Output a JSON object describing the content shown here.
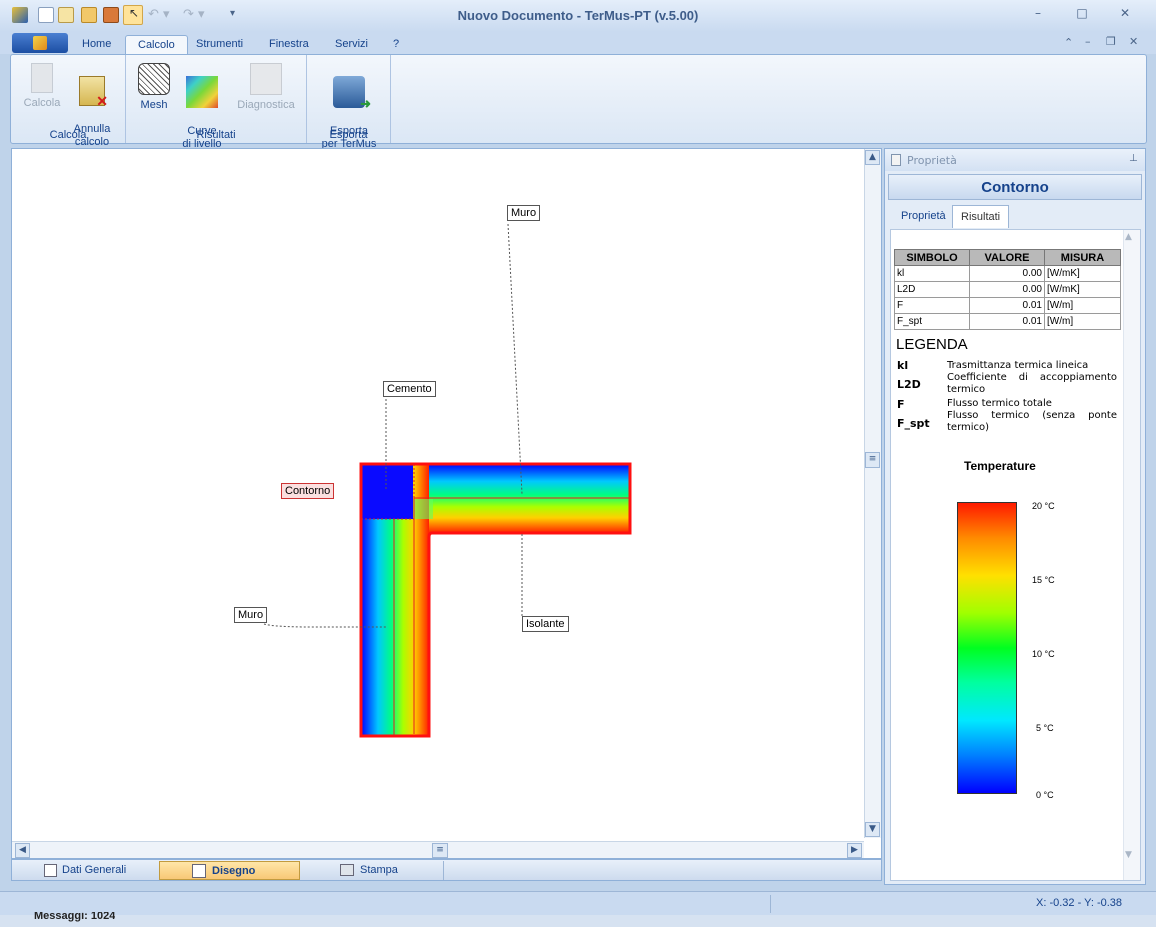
{
  "window": {
    "title": "Nuovo Documento - TerMus-PT (v.5.00)",
    "minimize": "–",
    "maximize": "□",
    "close": "✕",
    "qat_icons": [
      "app-icon",
      "new-doc-icon",
      "edit-icon",
      "open-folder-icon",
      "save-icon",
      "pointer-icon",
      "undo-icon",
      "redo-icon",
      "customize-icon"
    ]
  },
  "menu": {
    "tabs": [
      "Home",
      "Calcolo",
      "Strumenti",
      "Finestra",
      "Servizi",
      "?"
    ],
    "active_tab": "Calcolo",
    "right_controls": [
      "⌃",
      "–",
      "❐",
      "✕"
    ]
  },
  "ribbon": {
    "groups": [
      {
        "label": "Calcola",
        "buttons": [
          {
            "label": "Calcola",
            "enabled": false,
            "icon": "calculator-icon"
          },
          {
            "label": "Annulla\ncalcolo",
            "enabled": true,
            "icon": "cancel-calc-icon"
          }
        ]
      },
      {
        "label": "Risultati",
        "buttons": [
          {
            "label": "Mesh",
            "enabled": true,
            "icon": "mesh-icon"
          },
          {
            "label": "Curve\ndi livello",
            "enabled": true,
            "icon": "level-curves-icon"
          },
          {
            "label": "Diagnostica",
            "enabled": false,
            "icon": "diagnostic-icon"
          }
        ]
      },
      {
        "label": "Esporta",
        "buttons": [
          {
            "label": "Esporta\nper TerMus",
            "enabled": true,
            "icon": "export-termus-icon"
          }
        ]
      }
    ]
  },
  "drawing": {
    "labels": {
      "muro_top": "Muro",
      "cemento": "Cemento",
      "contorno": "Contorno",
      "muro_left": "Muro",
      "isolante": "Isolante"
    }
  },
  "bottom_tabs": [
    {
      "label": "Dati Generali",
      "icon": "general-data-icon",
      "active": false
    },
    {
      "label": "Disegno",
      "icon": "drawing-icon",
      "active": true
    },
    {
      "label": "Stampa",
      "icon": "print-icon",
      "active": false
    }
  ],
  "status": {
    "coords": "X: -0.32 - Y: -0.38",
    "messages": "Messaggi: 1024"
  },
  "properties": {
    "header": "Proprietà",
    "title": "Contorno",
    "tabs": [
      "Proprietà",
      "Risultati"
    ],
    "active_tab": "Risultati",
    "table": {
      "headers": [
        "SIMBOLO",
        "VALORE",
        "MISURA"
      ],
      "rows": [
        [
          "kl",
          "0.00",
          "[W/mK]"
        ],
        [
          "L2D",
          "0.00",
          "[W/mK]"
        ],
        [
          "F",
          "0.01",
          "[W/m]"
        ],
        [
          "F_spt",
          "0.01",
          "[W/m]"
        ]
      ]
    },
    "legend_title": "LEGENDA",
    "legend": [
      {
        "sym": "kl",
        "desc": "Trasmittanza termica lineica"
      },
      {
        "sym": "L2D",
        "desc": "Coefficiente di accoppiamento termico"
      },
      {
        "sym": "F",
        "desc": "Flusso termico totale"
      },
      {
        "sym": "F_spt",
        "desc": "Flusso termico (senza ponte termico)"
      }
    ],
    "colorbar_title": "Temperature",
    "colorbar_ticks": [
      "20 °C",
      "15 °C",
      "10 °C",
      "5 °C",
      "0 °C"
    ]
  }
}
